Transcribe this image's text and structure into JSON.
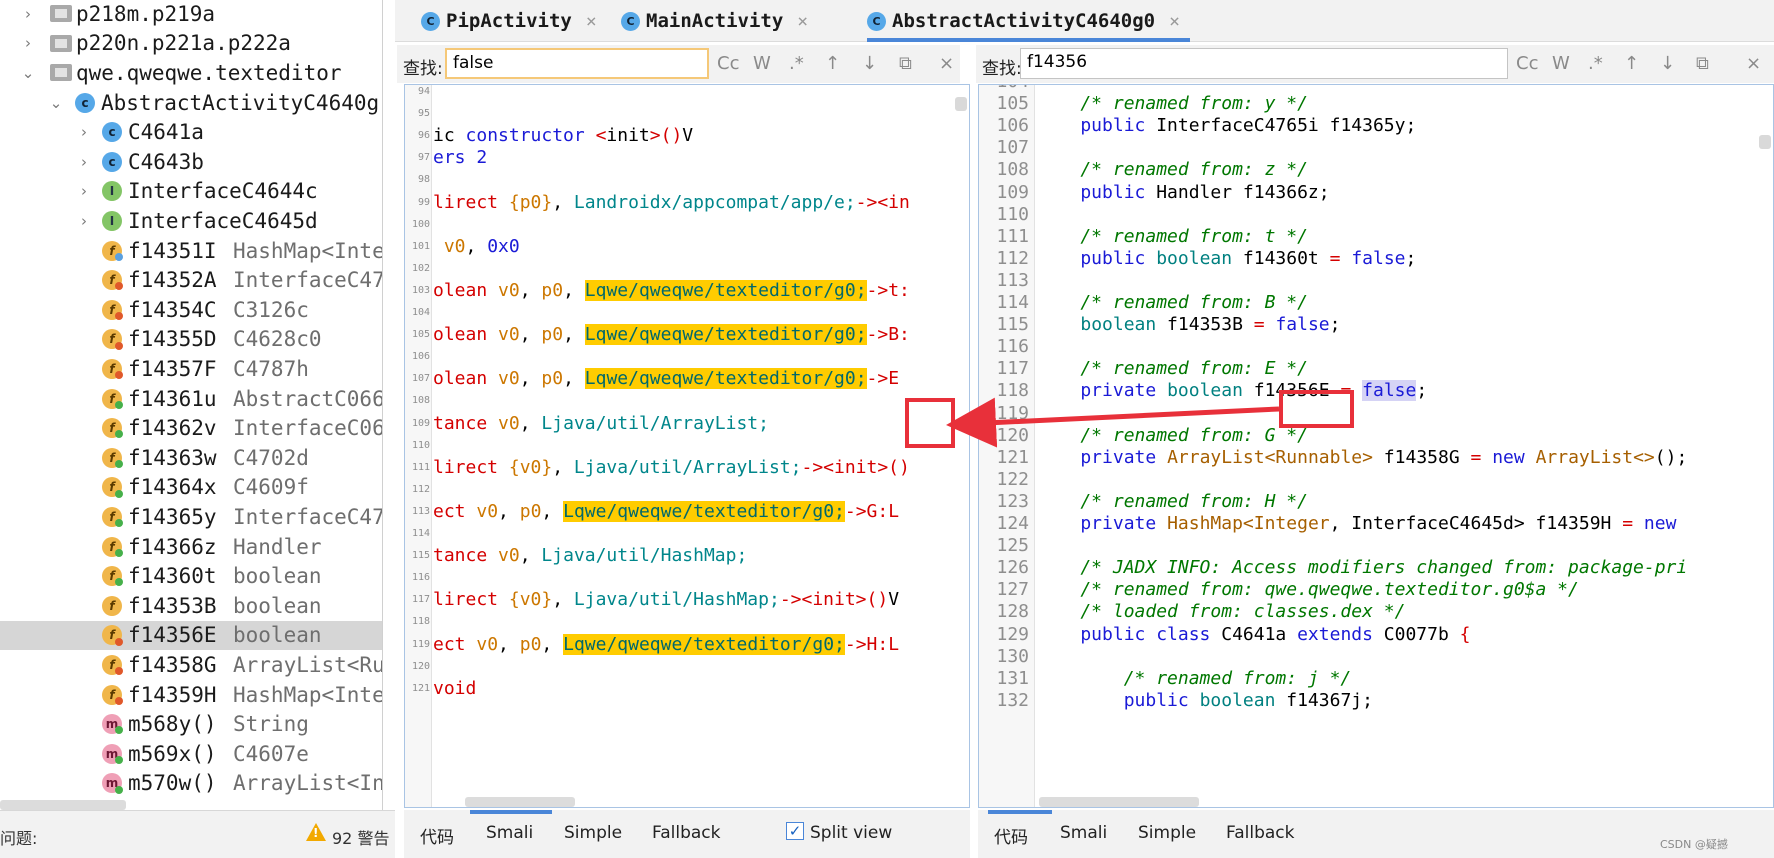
{
  "tree": {
    "rows": [
      {
        "name": "p218m.p219a",
        "type": "",
        "icon": "package-icon",
        "arrow": "›",
        "indent": 0
      },
      {
        "name": "p220n.p221a.p222a",
        "type": "",
        "icon": "package-icon",
        "arrow": "›",
        "indent": 0
      },
      {
        "name": "qwe.qweqwe.texteditor",
        "type": "",
        "icon": "package-icon",
        "arrow": "⌄",
        "indent": 0
      },
      {
        "name": "AbstractActivityC4640g",
        "type": "",
        "icon": "class-icon",
        "arrow": "⌄",
        "indent": 1
      },
      {
        "name": "C4641a",
        "type": "",
        "icon": "class-icon",
        "arrow": "›",
        "indent": 2
      },
      {
        "name": "C4643b",
        "type": "",
        "icon": "class-icon",
        "arrow": "›",
        "indent": 2
      },
      {
        "name": "InterfaceC4644c",
        "type": "",
        "icon": "interface-icon",
        "arrow": "›",
        "indent": 2
      },
      {
        "name": "InterfaceC4645d",
        "type": "",
        "icon": "interface-icon",
        "arrow": "›",
        "indent": 2
      },
      {
        "name": "f14351I",
        "type": "HashMap<Inte",
        "icon": "field-icon",
        "arrow": "",
        "indent": 2,
        "dot": "#5aa0e0"
      },
      {
        "name": "f14352A",
        "type": "InterfaceC47",
        "icon": "field-icon",
        "arrow": "",
        "indent": 2,
        "dot": "#e0582a"
      },
      {
        "name": "f14354C",
        "type": "C3126c",
        "icon": "field-icon",
        "arrow": "",
        "indent": 2,
        "dot": "#e0582a"
      },
      {
        "name": "f14355D",
        "type": "C4628c0",
        "icon": "field-icon",
        "arrow": "",
        "indent": 2,
        "dot": "#e0582a"
      },
      {
        "name": "f14357F",
        "type": "C4787h",
        "icon": "field-icon",
        "arrow": "",
        "indent": 2,
        "dot": "#e0582a"
      },
      {
        "name": "f14361u",
        "type": "AbstractC066",
        "icon": "field-icon",
        "arrow": "",
        "indent": 2,
        "dot": "#46b04a"
      },
      {
        "name": "f14362v",
        "type": "InterfaceC06",
        "icon": "field-icon",
        "arrow": "",
        "indent": 2,
        "dot": "#46b04a"
      },
      {
        "name": "f14363w",
        "type": "C4702d",
        "icon": "field-icon",
        "arrow": "",
        "indent": 2,
        "dot": "#46b04a"
      },
      {
        "name": "f14364x",
        "type": "C4609f",
        "icon": "field-icon",
        "arrow": "",
        "indent": 2,
        "dot": "#46b04a"
      },
      {
        "name": "f14365y",
        "type": "InterfaceC47",
        "icon": "field-icon",
        "arrow": "",
        "indent": 2,
        "dot": "#46b04a"
      },
      {
        "name": "f14366z",
        "type": "Handler",
        "icon": "field-icon",
        "arrow": "",
        "indent": 2,
        "dot": "#46b04a"
      },
      {
        "name": "f14360t",
        "type": "boolean",
        "icon": "field-icon",
        "arrow": "",
        "indent": 2,
        "dot": "#46b04a"
      },
      {
        "name": "f14353B",
        "type": "boolean",
        "icon": "field-icon",
        "arrow": "",
        "indent": 2,
        "dot": ""
      },
      {
        "name": "f14356E",
        "type": "boolean",
        "icon": "field-icon",
        "arrow": "",
        "indent": 2,
        "dot": "#e0582a",
        "selected": true
      },
      {
        "name": "f14358G",
        "type": "ArrayList<Ru",
        "icon": "field-icon",
        "arrow": "",
        "indent": 2,
        "dot": "#e0582a"
      },
      {
        "name": "f14359H",
        "type": "HashMap<Inte",
        "icon": "field-icon",
        "arrow": "",
        "indent": 2,
        "dot": "#e0582a"
      },
      {
        "name": "m568y()",
        "type": "String",
        "icon": "method-icon",
        "arrow": "",
        "indent": 2,
        "dot": "#46b04a"
      },
      {
        "name": "m569x()",
        "type": "C4607e",
        "icon": "method-icon",
        "arrow": "",
        "indent": 2,
        "dot": "#46b04a"
      },
      {
        "name": "m570w()",
        "type": "ArrayList<In",
        "icon": "method-icon",
        "arrow": "",
        "indent": 2,
        "dot": "#46b04a"
      }
    ]
  },
  "status": {
    "issues_label": "问题:",
    "warnings": "92 警告"
  },
  "tabs": [
    {
      "label": "PipActivity",
      "active": false
    },
    {
      "label": "MainActivity",
      "active": false
    },
    {
      "label": "AbstractActivityC4640g0",
      "active": true
    }
  ],
  "search_left": {
    "label": "查找:",
    "value": "false"
  },
  "search_right": {
    "label": "查找:",
    "value": "f14356"
  },
  "search_buttons": [
    "Cc",
    "W",
    ".*",
    "↑",
    "↓",
    "⧉",
    "×"
  ],
  "smali_lines": [
    {
      "n": "94",
      "segs": []
    },
    {
      "n": "95",
      "segs": []
    },
    {
      "n": "96",
      "segs": [
        [
          "",
          "ic "
        ],
        [
          "kw",
          "constructor"
        ],
        [
          "",
          " "
        ],
        [
          "smali-red",
          "<"
        ],
        [
          "",
          "init"
        ],
        [
          "smali-red",
          ">()"
        ],
        [
          "",
          "V"
        ]
      ]
    },
    {
      "n": "97",
      "segs": [
        [
          "kw",
          "ers"
        ],
        [
          "",
          " "
        ],
        [
          "kw",
          "2"
        ]
      ]
    },
    {
      "n": "98",
      "segs": []
    },
    {
      "n": "99",
      "segs": [
        [
          "smali-red",
          "lirect "
        ],
        [
          "smali-orange",
          "{p0}"
        ],
        [
          "",
          ", "
        ],
        [
          "smali-teal",
          "Landroidx/appcompat/app/e;"
        ],
        [
          "smali-red",
          "-><in"
        ]
      ]
    },
    {
      "n": "100",
      "segs": []
    },
    {
      "n": "101",
      "segs": [
        [
          "",
          " "
        ],
        [
          "smali-orange",
          "v0"
        ],
        [
          "",
          ", "
        ],
        [
          "kw",
          "0x0"
        ]
      ]
    },
    {
      "n": "102",
      "segs": []
    },
    {
      "n": "103",
      "segs": [
        [
          "smali-red",
          "olean "
        ],
        [
          "smali-orange",
          "v0"
        ],
        [
          "",
          ", "
        ],
        [
          "smali-orange",
          "p0"
        ],
        [
          "",
          ", "
        ],
        [
          "hl",
          "Lqwe/qweqwe/texteditor/g0;"
        ],
        [
          "smali-red",
          "->t:"
        ]
      ]
    },
    {
      "n": "104",
      "segs": []
    },
    {
      "n": "105",
      "segs": [
        [
          "smali-red",
          "olean "
        ],
        [
          "smali-orange",
          "v0"
        ],
        [
          "",
          ", "
        ],
        [
          "smali-orange",
          "p0"
        ],
        [
          "",
          ", "
        ],
        [
          "hl",
          "Lqwe/qweqwe/texteditor/g0;"
        ],
        [
          "smali-red",
          "->B:"
        ]
      ]
    },
    {
      "n": "106",
      "segs": []
    },
    {
      "n": "107",
      "segs": [
        [
          "smali-red",
          "olean "
        ],
        [
          "smali-orange",
          "v0"
        ],
        [
          "",
          ", "
        ],
        [
          "smali-orange",
          "p0"
        ],
        [
          "",
          ", "
        ],
        [
          "hl",
          "Lqwe/qweqwe/texteditor/g0;"
        ],
        [
          "smali-red",
          "->E"
        ]
      ]
    },
    {
      "n": "108",
      "segs": []
    },
    {
      "n": "109",
      "segs": [
        [
          "smali-red",
          "tance "
        ],
        [
          "smali-orange",
          "v0"
        ],
        [
          "",
          ", "
        ],
        [
          "smali-teal",
          "Ljava/util/ArrayList;"
        ]
      ]
    },
    {
      "n": "110",
      "segs": []
    },
    {
      "n": "111",
      "segs": [
        [
          "smali-red",
          "lirect "
        ],
        [
          "smali-orange",
          "{v0}"
        ],
        [
          "",
          ", "
        ],
        [
          "smali-teal",
          "Ljava/util/ArrayList;"
        ],
        [
          "smali-red",
          "-><init>()"
        ]
      ]
    },
    {
      "n": "112",
      "segs": []
    },
    {
      "n": "113",
      "segs": [
        [
          "smali-red",
          "ect "
        ],
        [
          "smali-orange",
          "v0"
        ],
        [
          "",
          ", "
        ],
        [
          "smali-orange",
          "p0"
        ],
        [
          "",
          ", "
        ],
        [
          "hl",
          "Lqwe/qweqwe/texteditor/g0;"
        ],
        [
          "smali-red",
          "->G:L"
        ]
      ]
    },
    {
      "n": "114",
      "segs": []
    },
    {
      "n": "115",
      "segs": [
        [
          "smali-red",
          "tance "
        ],
        [
          "smali-orange",
          "v0"
        ],
        [
          "",
          ", "
        ],
        [
          "smali-teal",
          "Ljava/util/HashMap;"
        ]
      ]
    },
    {
      "n": "116",
      "segs": []
    },
    {
      "n": "117",
      "segs": [
        [
          "smali-red",
          "lirect "
        ],
        [
          "smali-orange",
          "{v0}"
        ],
        [
          "",
          ", "
        ],
        [
          "smali-teal",
          "Ljava/util/HashMap;"
        ],
        [
          "smali-red",
          "-><init>()"
        ],
        [
          "",
          "V"
        ]
      ]
    },
    {
      "n": "118",
      "segs": []
    },
    {
      "n": "119",
      "segs": [
        [
          "smali-red",
          "ect "
        ],
        [
          "smali-orange",
          "v0"
        ],
        [
          "",
          ", "
        ],
        [
          "smali-orange",
          "p0"
        ],
        [
          "",
          ", "
        ],
        [
          "hl",
          "Lqwe/qweqwe/texteditor/g0;"
        ],
        [
          "smali-red",
          "->H:L"
        ]
      ]
    },
    {
      "n": "120",
      "segs": []
    },
    {
      "n": "121",
      "segs": [
        [
          "smali-red",
          "void"
        ]
      ]
    }
  ],
  "java_lines": [
    {
      "n": "104",
      "segs": []
    },
    {
      "n": "105",
      "segs": [
        [
          "cmt",
          "    /* renamed from: y */"
        ]
      ]
    },
    {
      "n": "106",
      "segs": [
        [
          "kw",
          "    public"
        ],
        [
          "",
          " InterfaceC4765i f14365y;"
        ]
      ]
    },
    {
      "n": "107",
      "segs": []
    },
    {
      "n": "108",
      "segs": [
        [
          "cmt",
          "    /* renamed from: z */"
        ]
      ]
    },
    {
      "n": "109",
      "segs": [
        [
          "kw",
          "    public"
        ],
        [
          "",
          " Handler f14366z;"
        ]
      ]
    },
    {
      "n": "110",
      "segs": []
    },
    {
      "n": "111",
      "segs": [
        [
          "cmt",
          "    /* renamed from: t */"
        ]
      ]
    },
    {
      "n": "112",
      "segs": [
        [
          "kw",
          "    public"
        ],
        [
          "",
          " "
        ],
        [
          "kw2",
          "boolean"
        ],
        [
          "",
          " f14360t "
        ],
        [
          "op",
          "="
        ],
        [
          "",
          " "
        ],
        [
          "kw",
          "false"
        ],
        [
          "",
          ";"
        ]
      ]
    },
    {
      "n": "113",
      "segs": []
    },
    {
      "n": "114",
      "segs": [
        [
          "cmt",
          "    /* renamed from: B */"
        ]
      ]
    },
    {
      "n": "115",
      "segs": [
        [
          "",
          "    "
        ],
        [
          "kw2",
          "boolean"
        ],
        [
          "",
          " f14353B "
        ],
        [
          "op",
          "="
        ],
        [
          "",
          " "
        ],
        [
          "kw",
          "false"
        ],
        [
          "",
          ";"
        ]
      ]
    },
    {
      "n": "116",
      "segs": []
    },
    {
      "n": "117",
      "segs": [
        [
          "cmt",
          "    /* renamed from: E */"
        ]
      ]
    },
    {
      "n": "118",
      "segs": [
        [
          "kw",
          "    private"
        ],
        [
          "",
          " "
        ],
        [
          "kw2",
          "boolean"
        ],
        [
          "",
          " f14356E "
        ],
        [
          "op",
          "="
        ],
        [
          "",
          " "
        ],
        [
          "kw hl2",
          "false"
        ],
        [
          "",
          ";"
        ]
      ]
    },
    {
      "n": "119",
      "segs": []
    },
    {
      "n": "120",
      "segs": [
        [
          "cmt",
          "    /* renamed from: G */"
        ]
      ]
    },
    {
      "n": "121",
      "segs": [
        [
          "kw",
          "    private"
        ],
        [
          "",
          " "
        ],
        [
          "typ",
          "ArrayList<Runnable>"
        ],
        [
          "",
          " f14358G "
        ],
        [
          "op",
          "="
        ],
        [
          "",
          " "
        ],
        [
          "kw",
          "new"
        ],
        [
          "",
          " "
        ],
        [
          "typ",
          "ArrayList<>"
        ],
        [
          "",
          "();"
        ]
      ]
    },
    {
      "n": "122",
      "segs": []
    },
    {
      "n": "123",
      "segs": [
        [
          "cmt",
          "    /* renamed from: H */"
        ]
      ]
    },
    {
      "n": "124",
      "segs": [
        [
          "kw",
          "    private"
        ],
        [
          "",
          " "
        ],
        [
          "typ",
          "HashMap<Integer"
        ],
        [
          "",
          ", InterfaceC4645d> f14359H "
        ],
        [
          "op",
          "="
        ],
        [
          "",
          " "
        ],
        [
          "kw",
          "new"
        ]
      ]
    },
    {
      "n": "125",
      "segs": []
    },
    {
      "n": "126",
      "segs": [
        [
          "cmt",
          "    /* JADX INFO: Access modifiers changed from: package-pri"
        ]
      ]
    },
    {
      "n": "127",
      "segs": [
        [
          "cmt",
          "    /* renamed from: qwe.qweqwe.texteditor.g0$a */"
        ]
      ]
    },
    {
      "n": "128",
      "segs": [
        [
          "cmt",
          "    /* loaded from: classes.dex */"
        ]
      ]
    },
    {
      "n": "129",
      "segs": [
        [
          "kw",
          "    public class"
        ],
        [
          "",
          " C4641a "
        ],
        [
          "kw",
          "extends"
        ],
        [
          "",
          " C0077b "
        ],
        [
          "op",
          "{"
        ]
      ]
    },
    {
      "n": "130",
      "segs": []
    },
    {
      "n": "131",
      "segs": [
        [
          "cmt",
          "        /* renamed from: j */"
        ]
      ]
    },
    {
      "n": "132",
      "segs": [
        [
          "kw",
          "        public"
        ],
        [
          "",
          " "
        ],
        [
          "kw2",
          "boolean"
        ],
        [
          "",
          " f14367j;"
        ]
      ]
    }
  ],
  "bottom_left": {
    "tabs": [
      "代码",
      "Smali",
      "Simple",
      "Fallback"
    ],
    "active": "Smali",
    "split_view_label": "Split view",
    "split_view_checked": "✓"
  },
  "bottom_right": {
    "tabs": [
      "代码",
      "Smali",
      "Simple",
      "Fallback"
    ],
    "active": "代码"
  },
  "watermark": "CSDN @疑撼"
}
